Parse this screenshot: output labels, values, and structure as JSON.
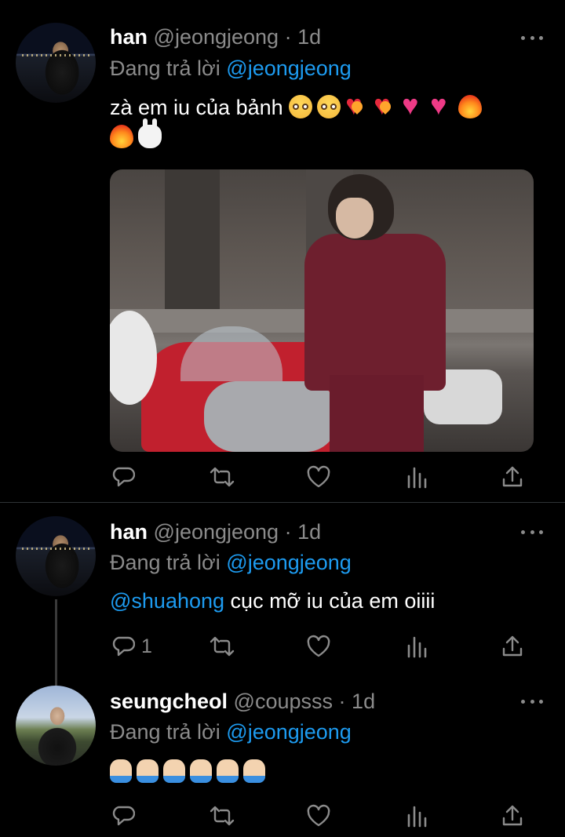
{
  "tweets": [
    {
      "name": "han",
      "handle": "@jeongjeong",
      "sep": "·",
      "time": "1d",
      "reply_prefix": "Đang trả lời",
      "reply_to": "@jeongjeong",
      "text": "zà em iu của bảnh",
      "emojis": [
        "pleading-face",
        "pleading-face",
        "heart-on-fire",
        "heart-on-fire",
        "growing-heart",
        "growing-heart",
        "fire",
        "fire",
        "rabbit-face"
      ],
      "media": "photo",
      "reply_count": "",
      "avatar": "han-avatar"
    },
    {
      "name": "han",
      "handle": "@jeongjeong",
      "sep": "·",
      "time": "1d",
      "reply_prefix": "Đang trả lời",
      "reply_to": "@jeongjeong",
      "mention": "@shuahong",
      "text": "cục mỡ iu của em oiiii",
      "reply_count": "1",
      "avatar": "han-avatar"
    },
    {
      "name": "seungcheol",
      "handle": "@coupsss",
      "sep": "·",
      "time": "1d",
      "reply_prefix": "Đang trả lời",
      "reply_to": "@jeongjeong",
      "emojis": [
        "folded-hands",
        "folded-hands",
        "folded-hands",
        "folded-hands",
        "folded-hands",
        "folded-hands"
      ],
      "reply_count": "",
      "avatar": "seungcheol-avatar"
    }
  ],
  "icons": {
    "reply": "reply-icon",
    "retweet": "retweet-icon",
    "like": "heart-icon",
    "views": "views-icon",
    "share": "share-icon",
    "more": "more-icon"
  },
  "colors": {
    "background": "#000000",
    "link": "#1d9bf0",
    "muted": "#8b8b8b",
    "text": "#ffffff"
  }
}
